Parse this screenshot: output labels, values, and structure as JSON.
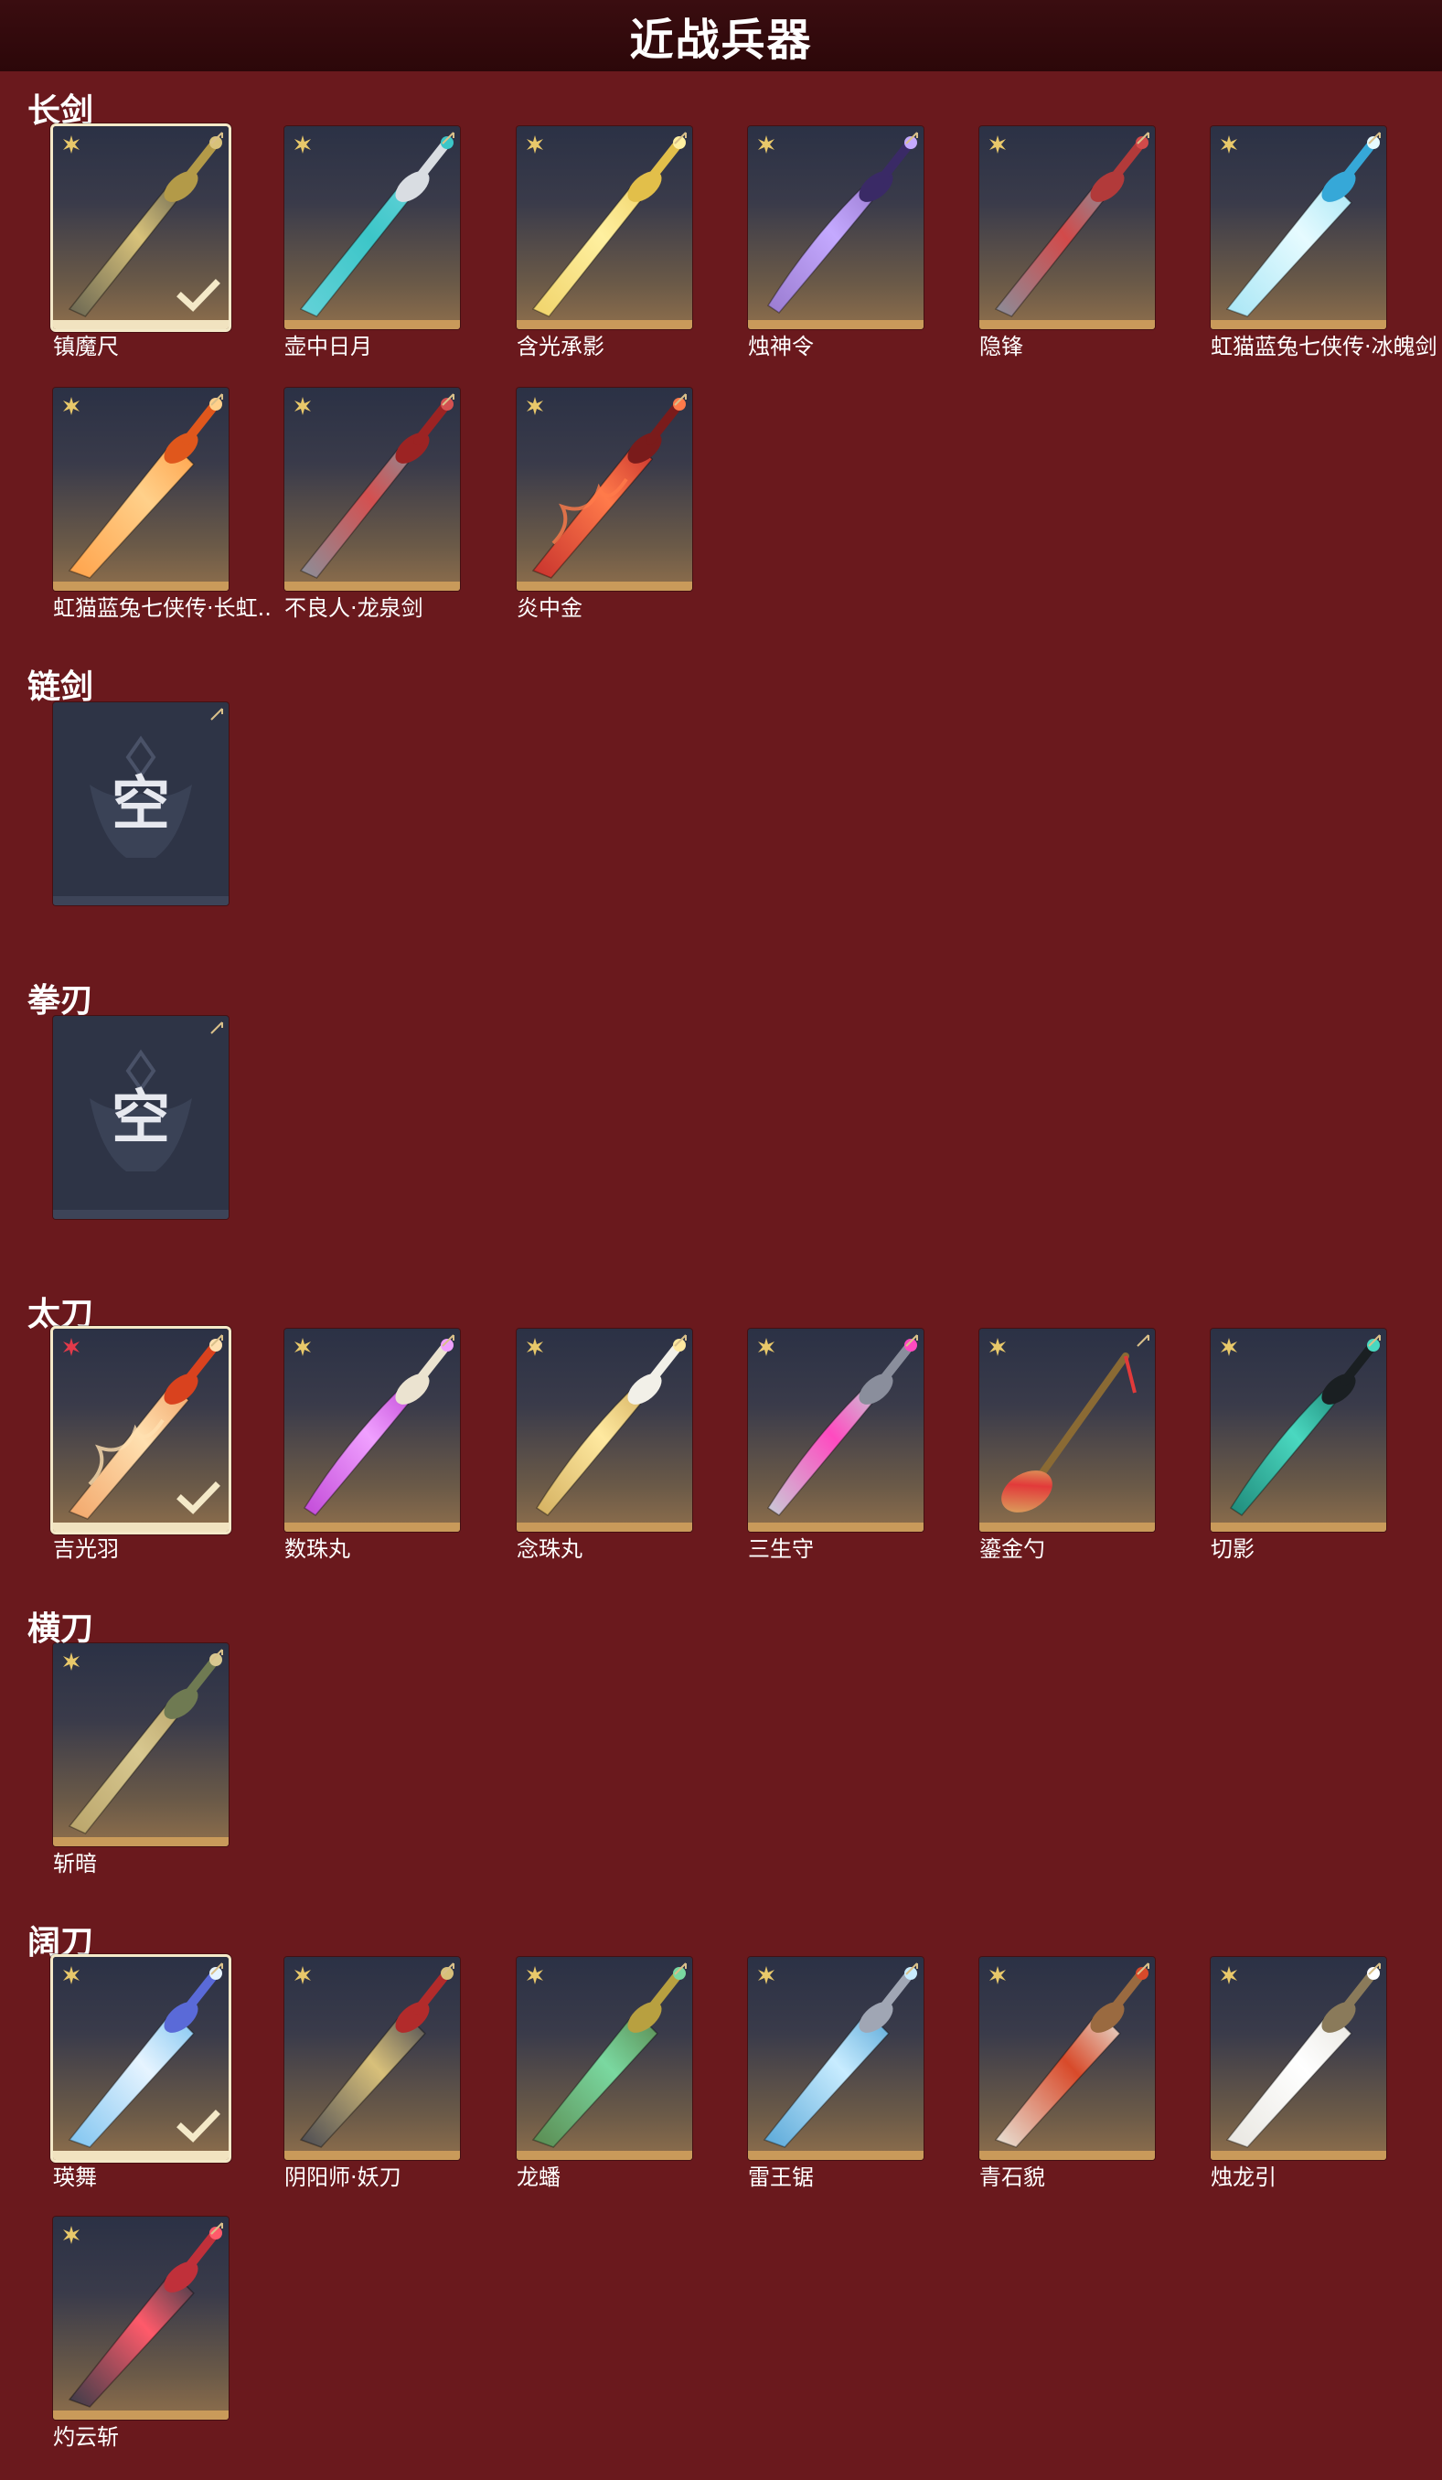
{
  "header": {
    "title": "近战兵器"
  },
  "empty_label": "空",
  "sections": [
    {
      "key": "longsword",
      "label": "长剑",
      "items": [
        {
          "name": "镇魔尺",
          "selected": true,
          "rarity": "gold",
          "blade": "#6a6652",
          "hilt": "#b39a48",
          "accent": "#d8c27a",
          "style": "straight"
        },
        {
          "name": "壶中日月",
          "selected": false,
          "rarity": "gold",
          "blade": "#64d2d8",
          "hilt": "#d9dde2",
          "accent": "#3cc6c8",
          "style": "straight"
        },
        {
          "name": "含光承影",
          "selected": false,
          "rarity": "gold",
          "blade": "#f0d36a",
          "hilt": "#e2bf4a",
          "accent": "#fff0a0",
          "style": "straight"
        },
        {
          "name": "烛神令",
          "selected": false,
          "rarity": "gold",
          "blade": "#9a7bd0",
          "hilt": "#3a2a66",
          "accent": "#c4a9ff",
          "style": "curved"
        },
        {
          "name": "隐锋",
          "selected": false,
          "rarity": "gold",
          "blade": "#8a8e9a",
          "hilt": "#b23a3a",
          "accent": "#d24a4a",
          "style": "straight"
        },
        {
          "name": "虹猫蓝兔七侠传·冰魄剑",
          "selected": false,
          "rarity": "gold",
          "blade": "#a8e6f5",
          "hilt": "#36a8d8",
          "accent": "#e6fbff",
          "style": "wide"
        }
      ]
    },
    {
      "key": "longsword2",
      "label": "",
      "items": [
        {
          "name": "虹猫蓝兔七侠传·长虹剑",
          "display_name": "虹猫蓝兔七侠传·长虹..",
          "selected": false,
          "rarity": "gold",
          "blade": "#ffa24a",
          "hilt": "#e0571c",
          "accent": "#ffd08a",
          "style": "wide"
        },
        {
          "name": "不良人·龙泉剑",
          "selected": false,
          "rarity": "gold",
          "blade": "#8b8f99",
          "hilt": "#9c2323",
          "accent": "#d45050",
          "style": "straight"
        },
        {
          "name": "炎中金",
          "selected": false,
          "rarity": "gold",
          "blade": "#c7322d",
          "hilt": "#7a1b1b",
          "accent": "#ff7a4a",
          "style": "flame"
        }
      ]
    },
    {
      "key": "chainsword",
      "label": "链剑",
      "items": []
    },
    {
      "key": "fistblade",
      "label": "拳刃",
      "items": []
    },
    {
      "key": "katana",
      "label": "太刀",
      "items": [
        {
          "name": "吉光羽",
          "selected": true,
          "rarity": "red",
          "blade": "#f2a66a",
          "hilt": "#d9421e",
          "accent": "#ffe0b0",
          "style": "flame"
        },
        {
          "name": "数珠丸",
          "selected": false,
          "rarity": "gold",
          "blade": "#c24ad8",
          "hilt": "#ebe3d0",
          "accent": "#f0a0ff",
          "style": "curved"
        },
        {
          "name": "念珠丸",
          "selected": false,
          "rarity": "gold",
          "blade": "#d4b060",
          "hilt": "#f2f0e8",
          "accent": "#ffe9a0",
          "style": "curved"
        },
        {
          "name": "三生守",
          "selected": false,
          "rarity": "gold",
          "blade": "#c8ccd6",
          "hilt": "#8a8e9c",
          "accent": "#ff4ac0",
          "style": "curved"
        },
        {
          "name": "鎏金勺",
          "selected": false,
          "rarity": "gold",
          "blade": "#d9b864",
          "hilt": "#8a6a34",
          "accent": "#e23a3a",
          "style": "spoon"
        },
        {
          "name": "切影",
          "selected": false,
          "rarity": "gold",
          "blade": "#1f8a7a",
          "hilt": "#1a1f22",
          "accent": "#4ad8c0",
          "style": "curved"
        }
      ]
    },
    {
      "key": "hengdao",
      "label": "横刀",
      "items": [
        {
          "name": "斩暗",
          "selected": false,
          "rarity": "gold",
          "blade": "#b9a46a",
          "hilt": "#6f7a52",
          "accent": "#d8c890",
          "style": "straight"
        }
      ]
    },
    {
      "key": "broadblade",
      "label": "阔刀",
      "items": [
        {
          "name": "瑛舞",
          "selected": true,
          "rarity": "gold",
          "blade": "#7fc4f0",
          "hilt": "#5a6ad8",
          "accent": "#e6f4ff",
          "style": "wide"
        },
        {
          "name": "阴阳师·妖刀",
          "selected": false,
          "rarity": "gold",
          "blade": "#4a4a52",
          "hilt": "#b22b2b",
          "accent": "#d8c07a",
          "style": "wide"
        },
        {
          "name": "龙蟠",
          "selected": false,
          "rarity": "gold",
          "blade": "#5a8a50",
          "hilt": "#b8a040",
          "accent": "#7ad8a0",
          "style": "wide"
        },
        {
          "name": "雷王锯",
          "selected": false,
          "rarity": "gold",
          "blade": "#5aa8d8",
          "hilt": "#a0a6b4",
          "accent": "#c8ecff",
          "style": "wide"
        },
        {
          "name": "青石貌",
          "selected": false,
          "rarity": "gold",
          "blade": "#e8e4d8",
          "hilt": "#9a6a40",
          "accent": "#d84a2a",
          "style": "wide"
        },
        {
          "name": "烛龙引",
          "selected": false,
          "rarity": "gold",
          "blade": "#e8e6e0",
          "hilt": "#8a7a5a",
          "accent": "#ffffff",
          "style": "wide"
        }
      ]
    },
    {
      "key": "broadblade2",
      "label": "",
      "items": [
        {
          "name": "灼云斩",
          "selected": false,
          "rarity": "gold",
          "blade": "#3a3c48",
          "hilt": "#c0303a",
          "accent": "#ff5a6a",
          "style": "wide"
        }
      ]
    }
  ],
  "colors": {
    "background": "#6a191d",
    "header_bg": "#2c0709",
    "gold_star": "#e8c86a",
    "red_star": "#e23a4a",
    "selected_border": "#f4e9c8"
  }
}
